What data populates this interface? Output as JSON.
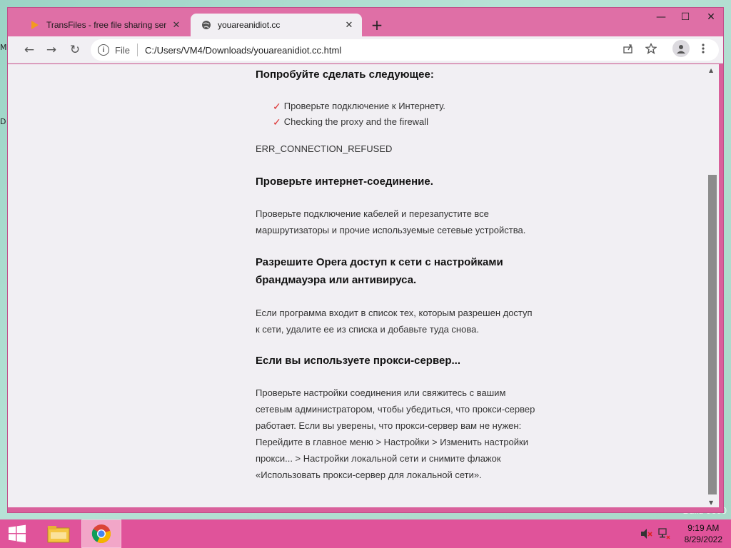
{
  "desktop": {
    "left_fragment_1": "M",
    "left_fragment_2": "D",
    "watermark": "Build 9600"
  },
  "browser": {
    "tabs": [
      {
        "title": "TransFiles - free file sharing servi",
        "icon": "transfiles-icon",
        "active": false
      },
      {
        "title": "youareanidiot.cc",
        "icon": "globe-icon",
        "active": true
      }
    ],
    "new_tab_label": "+",
    "window_controls": {
      "minimize": "—",
      "maximize": "☐",
      "close": "✕"
    },
    "toolbar": {
      "back": "←",
      "forward": "→",
      "reload": "↻",
      "scheme": "File",
      "url": "C:/Users/VM4/Downloads/youareanidiot.cc.html"
    }
  },
  "page": {
    "heading_try": "Попробуйте сделать следующее:",
    "bullets": [
      "Проверьте подключение к Интернету.",
      "Checking the proxy and the firewall"
    ],
    "error_code": "ERR_CONNECTION_REFUSED",
    "section1_title": "Проверьте интернет-соединение.",
    "section1_line1": "Проверьте подключение кабелей и перезапустите все",
    "section1_line2": "маршрутизаторы и прочие используемые сетевые устройства.",
    "section2_title_line1": "Разрешите Opera доступ к сети с настройками",
    "section2_title_line2": "брандмауэра или антивируса.",
    "section2_line1": "Если программа входит в список тех, которым разрешен доступ",
    "section2_line2": "к сети, удалите ее из списка и добавьте туда снова.",
    "section3_title": "Если вы используете прокси-сервер...",
    "section3_lines": [
      "Проверьте настройки соединения или свяжитесь с вашим",
      "сетевым администратором, чтобы убедиться, что прокси-сервер",
      "работает. Если вы уверены, что прокси-сервер вам не нужен:",
      "Перейдите в главное меню > Настройки > Изменить настройки",
      "прокси... > Настройки локальной сети и снимите флажок",
      "«Использовать прокси-сервер для локальной сети»."
    ]
  },
  "taskbar": {
    "time": "9:19 AM",
    "date": "8/29/2022"
  }
}
